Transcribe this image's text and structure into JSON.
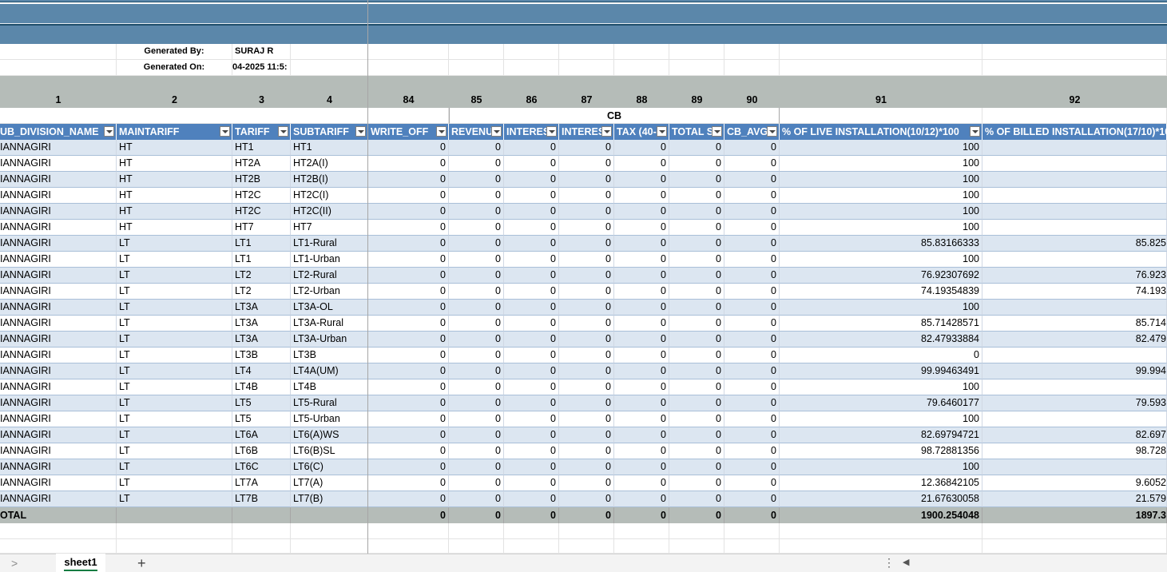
{
  "meta": {
    "generated_by_label": "Generated By:",
    "generated_by_value": "SURAJ R",
    "generated_on_label": "Generated On:",
    "generated_on_value": "04-2025 11:5:"
  },
  "index_numbers": [
    "1",
    "2",
    "3",
    "4",
    "84",
    "85",
    "86",
    "87",
    "88",
    "89",
    "90",
    "91",
    "92"
  ],
  "group_label": "CB",
  "headers": [
    "UB_DIVISION_NAME",
    "MAINTARIFF",
    "TARIFF",
    "SUBTARIFF",
    "WRITE_OFF",
    "REVENU",
    "INTERES",
    "INTERES",
    "TAX (40-",
    "TOTAL S",
    "CB_AVG",
    "% OF LIVE INSTALLATION(10/12)*100",
    "% OF BILLED INSTALLATION(17/10)*10"
  ],
  "rows": [
    [
      "IANNAGIRI",
      "HT",
      "HT1",
      "HT1",
      "0",
      "0",
      "0",
      "0",
      "0",
      "0",
      "0",
      "100",
      ""
    ],
    [
      "IANNAGIRI",
      "HT",
      "HT2A",
      "HT2A(I)",
      "0",
      "0",
      "0",
      "0",
      "0",
      "0",
      "0",
      "100",
      ""
    ],
    [
      "IANNAGIRI",
      "HT",
      "HT2B",
      "HT2B(I)",
      "0",
      "0",
      "0",
      "0",
      "0",
      "0",
      "0",
      "100",
      ""
    ],
    [
      "IANNAGIRI",
      "HT",
      "HT2C",
      "HT2C(I)",
      "0",
      "0",
      "0",
      "0",
      "0",
      "0",
      "0",
      "100",
      ""
    ],
    [
      "IANNAGIRI",
      "HT",
      "HT2C",
      "HT2C(II)",
      "0",
      "0",
      "0",
      "0",
      "0",
      "0",
      "0",
      "100",
      ""
    ],
    [
      "IANNAGIRI",
      "HT",
      "HT7",
      "HT7",
      "0",
      "0",
      "0",
      "0",
      "0",
      "0",
      "0",
      "100",
      ""
    ],
    [
      "IANNAGIRI",
      "LT",
      "LT1",
      "LT1-Rural",
      "0",
      "0",
      "0",
      "0",
      "0",
      "0",
      "0",
      "85.83166333",
      "85.825"
    ],
    [
      "IANNAGIRI",
      "LT",
      "LT1",
      "LT1-Urban",
      "0",
      "0",
      "0",
      "0",
      "0",
      "0",
      "0",
      "100",
      ""
    ],
    [
      "IANNAGIRI",
      "LT",
      "LT2",
      "LT2-Rural",
      "0",
      "0",
      "0",
      "0",
      "0",
      "0",
      "0",
      "76.92307692",
      "76.923"
    ],
    [
      "IANNAGIRI",
      "LT",
      "LT2",
      "LT2-Urban",
      "0",
      "0",
      "0",
      "0",
      "0",
      "0",
      "0",
      "74.19354839",
      "74.193"
    ],
    [
      "IANNAGIRI",
      "LT",
      "LT3A",
      "LT3A-OL",
      "0",
      "0",
      "0",
      "0",
      "0",
      "0",
      "0",
      "100",
      ""
    ],
    [
      "IANNAGIRI",
      "LT",
      "LT3A",
      "LT3A-Rural",
      "0",
      "0",
      "0",
      "0",
      "0",
      "0",
      "0",
      "85.71428571",
      "85.714"
    ],
    [
      "IANNAGIRI",
      "LT",
      "LT3A",
      "LT3A-Urban",
      "0",
      "0",
      "0",
      "0",
      "0",
      "0",
      "0",
      "82.47933884",
      "82.479"
    ],
    [
      "IANNAGIRI",
      "LT",
      "LT3B",
      "LT3B",
      "0",
      "0",
      "0",
      "0",
      "0",
      "0",
      "0",
      "0",
      ""
    ],
    [
      "IANNAGIRI",
      "LT",
      "LT4",
      "LT4A(UM)",
      "0",
      "0",
      "0",
      "0",
      "0",
      "0",
      "0",
      "99.99463491",
      "99.994"
    ],
    [
      "IANNAGIRI",
      "LT",
      "LT4B",
      "LT4B",
      "0",
      "0",
      "0",
      "0",
      "0",
      "0",
      "0",
      "100",
      ""
    ],
    [
      "IANNAGIRI",
      "LT",
      "LT5",
      "LT5-Rural",
      "0",
      "0",
      "0",
      "0",
      "0",
      "0",
      "0",
      "79.6460177",
      "79.593"
    ],
    [
      "IANNAGIRI",
      "LT",
      "LT5",
      "LT5-Urban",
      "0",
      "0",
      "0",
      "0",
      "0",
      "0",
      "0",
      "100",
      ""
    ],
    [
      "IANNAGIRI",
      "LT",
      "LT6A",
      "LT6(A)WS",
      "0",
      "0",
      "0",
      "0",
      "0",
      "0",
      "0",
      "82.69794721",
      "82.697"
    ],
    [
      "IANNAGIRI",
      "LT",
      "LT6B",
      "LT6(B)SL",
      "0",
      "0",
      "0",
      "0",
      "0",
      "0",
      "0",
      "98.72881356",
      "98.728"
    ],
    [
      "IANNAGIRI",
      "LT",
      "LT6C",
      "LT6(C)",
      "0",
      "0",
      "0",
      "0",
      "0",
      "0",
      "0",
      "100",
      ""
    ],
    [
      "IANNAGIRI",
      "LT",
      "LT7A",
      "LT7(A)",
      "0",
      "0",
      "0",
      "0",
      "0",
      "0",
      "0",
      "12.36842105",
      "9.6052"
    ],
    [
      "IANNAGIRI",
      "LT",
      "LT7B",
      "LT7(B)",
      "0",
      "0",
      "0",
      "0",
      "0",
      "0",
      "0",
      "21.67630058",
      "21.579"
    ]
  ],
  "total_row": [
    "OTAL",
    "",
    "",
    "",
    "0",
    "0",
    "0",
    "0",
    "0",
    "0",
    "0",
    "1900.254048",
    "1897.3"
  ],
  "tabbar": {
    "sheet_tab": "sheet1",
    "add_sheet": "+",
    "nav_prev": ">",
    "more": "⋮",
    "scroll_left": "◀"
  },
  "colors": {
    "header_fill": "#4f81bd",
    "band_fill": "#5b87aa",
    "row_alt_fill": "#dce6f1",
    "index_fill": "#b5bcb8"
  }
}
